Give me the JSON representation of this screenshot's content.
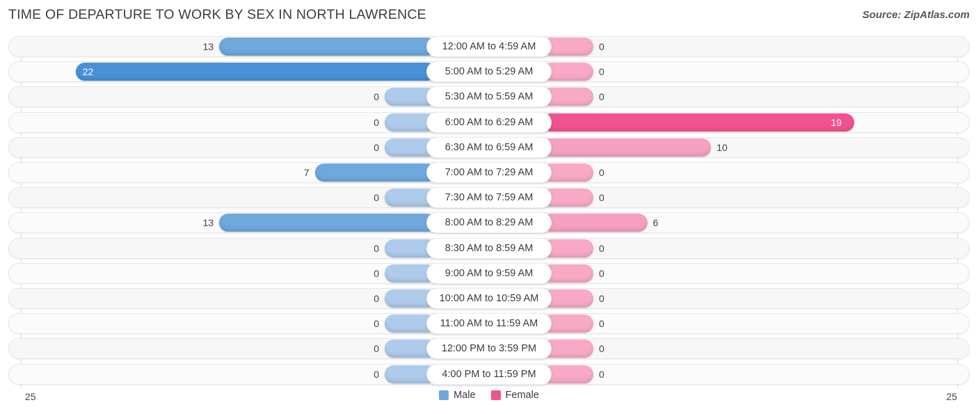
{
  "header": {
    "title": "TIME OF DEPARTURE TO WORK BY SEX IN NORTH LAWRENCE",
    "source": "Source: ZipAtlas.com"
  },
  "axis": {
    "left_max_label": "25",
    "right_max_label": "25"
  },
  "legend": {
    "items": [
      {
        "label": "Male",
        "color": "#6fa8dc"
      },
      {
        "label": "Female",
        "color": "#f2528f"
      }
    ]
  },
  "colors": {
    "male": "#6fa8dc",
    "male_strong": "#4a90d9",
    "male_zero": "#aecbec",
    "female": "#f4a0c0",
    "female_strong": "#f2528f",
    "female_zero": "#f7a9c6",
    "track": "#f7f7f7",
    "axis": "#d8d8dc"
  },
  "chart_data": {
    "type": "bar",
    "title": "TIME OF DEPARTURE TO WORK BY SEX IN NORTH LAWRENCE",
    "subtitle": "",
    "orientation": "horizontal-diverging",
    "xlabel": "",
    "ylabel": "",
    "xlim": [
      25,
      25
    ],
    "grid": false,
    "legend_position": "bottom-center",
    "categories": [
      "12:00 AM to 4:59 AM",
      "5:00 AM to 5:29 AM",
      "5:30 AM to 5:59 AM",
      "6:00 AM to 6:29 AM",
      "6:30 AM to 6:59 AM",
      "7:00 AM to 7:29 AM",
      "7:30 AM to 7:59 AM",
      "8:00 AM to 8:29 AM",
      "8:30 AM to 8:59 AM",
      "9:00 AM to 9:59 AM",
      "10:00 AM to 10:59 AM",
      "11:00 AM to 11:59 AM",
      "12:00 PM to 3:59 PM",
      "4:00 PM to 11:59 PM"
    ],
    "series": [
      {
        "name": "Male",
        "values": [
          13,
          22,
          0,
          0,
          0,
          7,
          0,
          13,
          0,
          0,
          0,
          0,
          0,
          0
        ]
      },
      {
        "name": "Female",
        "values": [
          0,
          0,
          0,
          19,
          10,
          0,
          0,
          6,
          0,
          0,
          0,
          0,
          0,
          0
        ]
      }
    ]
  },
  "rows": [
    {
      "label": "12:00 AM to 4:59 AM",
      "male": "13",
      "female": "0"
    },
    {
      "label": "5:00 AM to 5:29 AM",
      "male": "22",
      "female": "0"
    },
    {
      "label": "5:30 AM to 5:59 AM",
      "male": "0",
      "female": "0"
    },
    {
      "label": "6:00 AM to 6:29 AM",
      "male": "0",
      "female": "19"
    },
    {
      "label": "6:30 AM to 6:59 AM",
      "male": "0",
      "female": "10"
    },
    {
      "label": "7:00 AM to 7:29 AM",
      "male": "7",
      "female": "0"
    },
    {
      "label": "7:30 AM to 7:59 AM",
      "male": "0",
      "female": "0"
    },
    {
      "label": "8:00 AM to 8:29 AM",
      "male": "13",
      "female": "6"
    },
    {
      "label": "8:30 AM to 8:59 AM",
      "male": "0",
      "female": "0"
    },
    {
      "label": "9:00 AM to 9:59 AM",
      "male": "0",
      "female": "0"
    },
    {
      "label": "10:00 AM to 10:59 AM",
      "male": "0",
      "female": "0"
    },
    {
      "label": "11:00 AM to 11:59 AM",
      "male": "0",
      "female": "0"
    },
    {
      "label": "12:00 PM to 3:59 PM",
      "male": "0",
      "female": "0"
    },
    {
      "label": "4:00 PM to 11:59 PM",
      "male": "0",
      "female": "0"
    }
  ]
}
